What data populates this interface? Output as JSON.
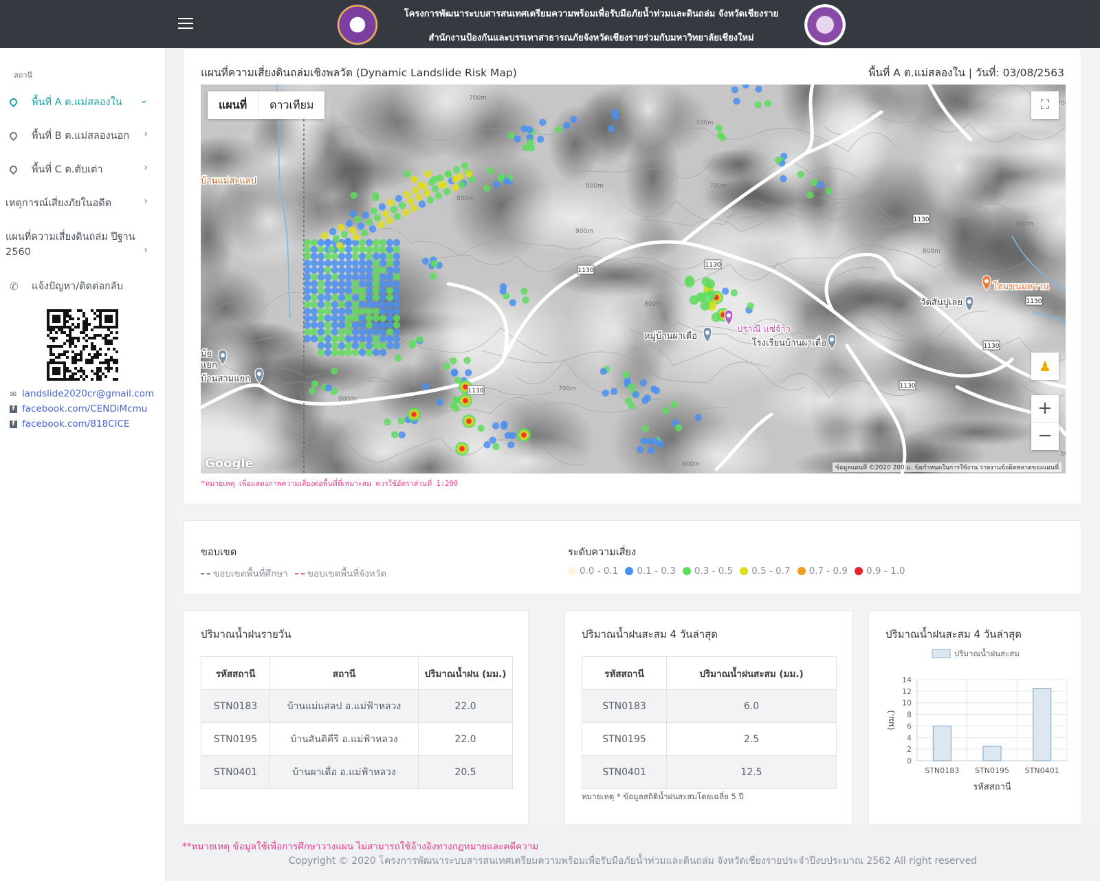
{
  "header": {
    "title_line1": "โครงการพัฒนาระบบสารสนเทศเตรียมความพร้อมเพื่อรับมือภัยน้ำท่วมและดินถล่ม จังหวัดเชียงราย",
    "title_line2": "สำนักงานป้องกันและบรรเทาสาธารณภัยจังหวัดเชียงรายร่วมกับมหาวิทยาลัยเชียงใหม่"
  },
  "sidebar": {
    "heading": "สถานี",
    "items": [
      {
        "label": "พื้นที่ A ต.แม่สลองใน",
        "icon": "map-pin-icon",
        "chevron": "⌄"
      },
      {
        "label": "พื้นที่ B ต.แม่สลองนอก",
        "icon": "map-pin-icon",
        "chevron": "›"
      },
      {
        "label": "พื้นที่ C ต.ตับเต่า",
        "icon": "map-pin-icon",
        "chevron": "›"
      },
      {
        "label": "เหตุการณ์เสี่ยงภัยในอดีต",
        "chevron": "›"
      },
      {
        "label": "แผนที่ความเสี่ยงดินถล่ม ปีฐาน 2560",
        "chevron": "›"
      },
      {
        "label": "แจ้งปัญหา/ติดต่อกลับ",
        "icon": "phone-icon"
      }
    ],
    "contacts": [
      {
        "text": "landslide2020cr@gmail.com",
        "icon": "envelope-icon"
      },
      {
        "text": "facebook.com/CENDiMcmu",
        "icon": "facebook-icon"
      },
      {
        "text": "facebook.com/818CICE",
        "icon": "facebook-icon"
      }
    ]
  },
  "map_card": {
    "title": "แผนที่ความเสี่ยงดินถล่มเชิงพลวัต (Dynamic Landslide Risk Map)",
    "subtitle": "พื้นที่ A ต.แม่สลองใน | วันที่: 03/08/2563",
    "map_type_tabs": [
      "แผนที่",
      "ดาวเทียม"
    ],
    "google_label": "Google",
    "attribution": "ข้อมูลแผนที่ ©2020   200 ม.   ข้อกำหนดในการใช้งาน   รายงานข้อผิดพลาดของแผนที่",
    "place_labels": {
      "p1": "บ้านแม่สะแลป",
      "p2": "หมู่บ้านผาเดื่อ",
      "p3": "ปราณี แซ่จ้าว",
      "p4": "โรงเรียนบ้านผาเดื่อ",
      "p5": "วัดสันปูเลย",
      "p6": "โฮมขนมหวาน",
      "p7": "บ้านสามแยก",
      "p8": "ม้ย",
      "p9": "แยก"
    },
    "road_labels": [
      "1130",
      "1130",
      "1130",
      "1130",
      "1130",
      "1130",
      "1130"
    ],
    "contour_labels": [
      "700m",
      "800m",
      "700m",
      "800m",
      "900m",
      "800m",
      "700m",
      "600m",
      "600m",
      "800m",
      "700m",
      "600m",
      "500m",
      "600m",
      "800m",
      "700m"
    ],
    "note": "*หมายเหตุ เพื่อแสดงภาพความเสี่ยงต่อพื้นที่ที่เหมาะสม ควรใช้อัตราส่วนที่ 1:200"
  },
  "legend": {
    "boundary_heading": "ขอบเขต",
    "boundary_items": [
      {
        "label": "ขอบเขตพื้นที่ศึกษา",
        "color": "#888888"
      },
      {
        "label": "ขอบเขตพื้นที่จังหวัด",
        "color": "#e57373"
      }
    ],
    "risk_heading": "ระดับความเสี่ยง",
    "risk_items": [
      {
        "label": "0.0 - 0.1",
        "color": "#fbf6de"
      },
      {
        "label": "0.1 - 0.3",
        "color": "#4a8ff0"
      },
      {
        "label": "0.3 - 0.5",
        "color": "#5fdc5f"
      },
      {
        "label": "0.5 - 0.7",
        "color": "#dede1a"
      },
      {
        "label": "0.7 - 0.9",
        "color": "#ee9b22"
      },
      {
        "label": "0.9 - 1.0",
        "color": "#e8222a"
      }
    ]
  },
  "daily_rain": {
    "title": "ปริมาณน้ำฝนรายวัน",
    "headers": [
      "รหัสสถานี",
      "สถานี",
      "ปริมาณน้ำฝน (มม.)"
    ],
    "rows": [
      [
        "STN0183",
        "บ้านแม่แสลป อ.แม่ฟ้าหลวง",
        "22.0"
      ],
      [
        "STN0195",
        "บ้านสันติคีรี อ.แม่ฟ้าหลวง",
        "22.0"
      ],
      [
        "STN0401",
        "บ้านผาเดื่อ อ.แม่ฟ้าหลวง",
        "20.5"
      ]
    ]
  },
  "accum_rain": {
    "title": "ปริมาณน้ำฝนสะสม 4 วันล่าสุด",
    "headers": [
      "รหัสสถานี",
      "ปริมาณน้ำฝนสะสม (มม.)"
    ],
    "rows": [
      [
        "STN0183",
        "6.0"
      ],
      [
        "STN0195",
        "2.5"
      ],
      [
        "STN0401",
        "12.5"
      ]
    ],
    "footnote": "หมายเหตุ * ข้อมูลสถิติน้ำฝนสะสมโดยเฉลี่ย 5 ปี"
  },
  "chart_card": {
    "title": "ปริมาณน้ำฝนสะสม 4 วันล่าสุด"
  },
  "chart_data": {
    "type": "bar",
    "categories": [
      "STN0183",
      "STN0195",
      "STN0401"
    ],
    "series": [
      {
        "name": "ปริมาณน้ำฝนสะสม",
        "values": [
          6.0,
          2.5,
          12.5
        ]
      }
    ],
    "xlabel": "รหัสสถานี",
    "ylabel": "(มม.)",
    "ylim": [
      0,
      14
    ],
    "yticks": [
      0,
      2,
      4,
      6,
      8,
      10,
      12,
      14
    ],
    "grid": true,
    "legend": "top",
    "bar_color": "#dde7f0",
    "bar_border": "#8fb0cc"
  },
  "footer": {
    "note": "**หมายเหตุ ข้อมูลใช้เพื่อการศึกษาวางแผน ไม่สามารถใช้อ้างอิงทางกฎหมายและคดีความ",
    "copyright": "Copyright © 2020 โครงการพัฒนาระบบสารสนเทศเตรียมความพร้อมเพื่อรับมือภัยน้ำท่วมและดินถล่ม จังหวัดเชียงรายประจำปีงบประมาณ 2562 All right reserved"
  }
}
